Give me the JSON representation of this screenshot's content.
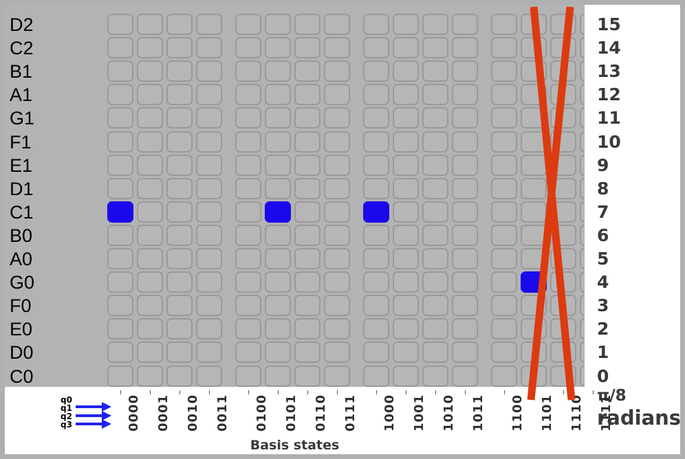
{
  "chart_data": {
    "type": "heatmap",
    "title": "",
    "xlabel": "Basis states",
    "ylabel": "",
    "x_tick_labels": [
      "0000",
      "0001",
      "0010",
      "0011",
      "0100",
      "0101",
      "0110",
      "0111",
      "1000",
      "1001",
      "1010",
      "1011",
      "1100",
      "1101",
      "1110",
      "1111"
    ],
    "y_tick_labels_left": [
      "D2",
      "C2",
      "B1",
      "A1",
      "G1",
      "F1",
      "E1",
      "D1",
      "C1",
      "B0",
      "A0",
      "G0",
      "F0",
      "E0",
      "D0",
      "C0"
    ],
    "y_tick_labels_right": [
      "15",
      "14",
      "13",
      "12",
      "11",
      "10",
      "9",
      "8",
      "7",
      "6",
      "5",
      "4",
      "3",
      "2",
      "1",
      "0"
    ],
    "right_axis_units_numerator": "π/8",
    "right_axis_units_label": "radians",
    "cell_on_color": "#1a09ec",
    "cell_off_color": "#b6b6b6",
    "cell_border_color": "#9a9a9a",
    "panel_bg_color": "#b3b3b3",
    "annotation_color": "#dd3a0f",
    "active_cells": [
      {
        "row_label": "C1",
        "row_index": 8,
        "value": 7,
        "column_index": 0,
        "state": "0000"
      },
      {
        "row_label": "C1",
        "row_index": 8,
        "value": 7,
        "column_index": 5,
        "state": "0101"
      },
      {
        "row_label": "C1",
        "row_index": 8,
        "value": 7,
        "column_index": 8,
        "state": "1000"
      },
      {
        "row_label": "G0",
        "row_index": 11,
        "value": 4,
        "column_index": 13,
        "state": "1101"
      }
    ],
    "annotations": [
      {
        "type": "cross-out",
        "shape": "x-mark",
        "columns": [
          "1110",
          "1111"
        ],
        "color": "#dd3a0f"
      }
    ],
    "qubit_labels": [
      "q0",
      "q1",
      "q2",
      "q3"
    ],
    "qubit_arrow_color": "#2222ee",
    "qubit_arrow_count": 3,
    "grid": true,
    "group_size": 4
  }
}
